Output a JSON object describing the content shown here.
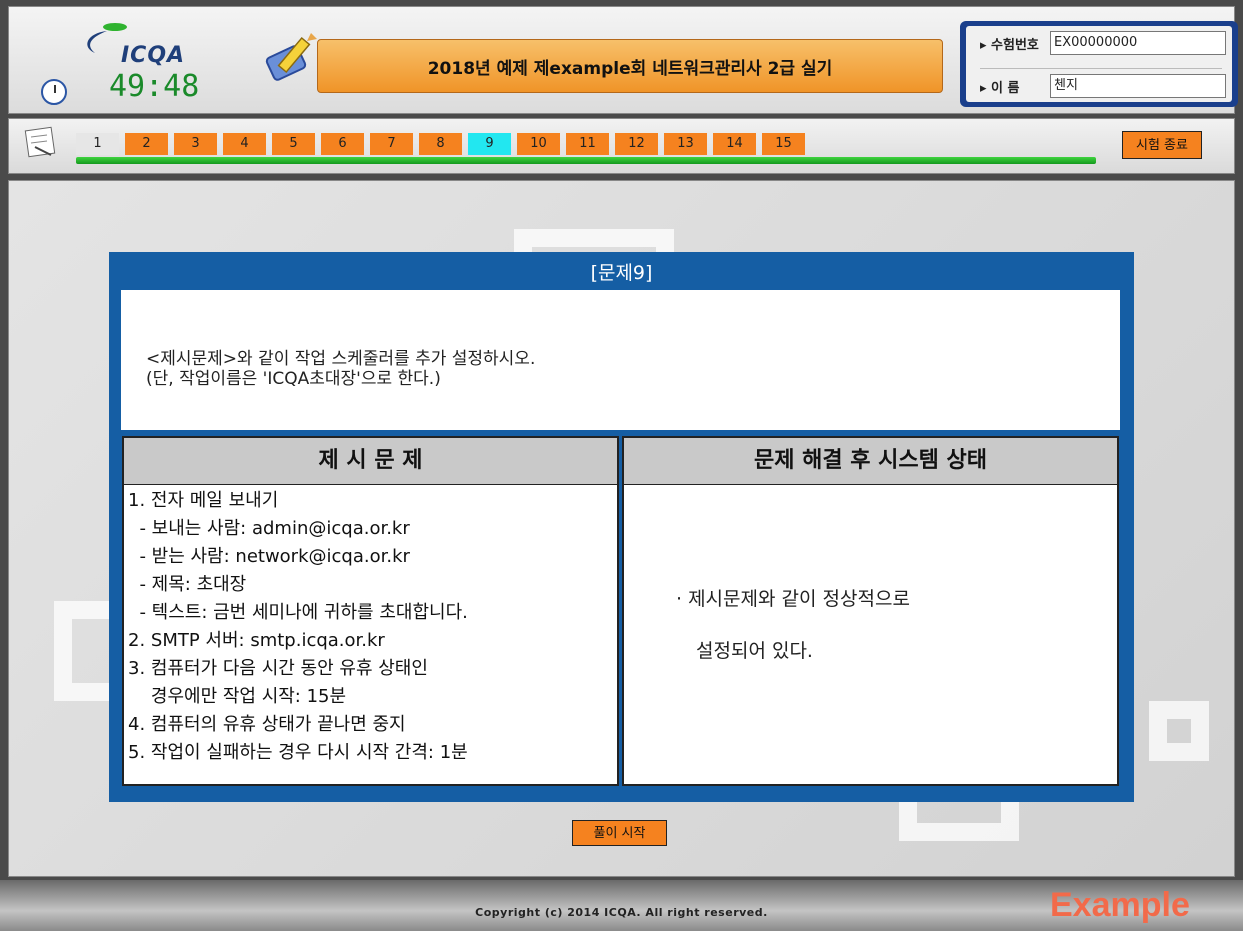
{
  "header": {
    "logo_text": "ICQA",
    "timer": "49:48",
    "title": "2018년 예제 제example회 네트워크관리사 2급 실기",
    "candidate": {
      "number_label": "▸ 수험번호",
      "number_value": "EX00000000",
      "name_label": "▸ 이     름",
      "name_value": "첸지"
    }
  },
  "nav": {
    "questions": [
      "1",
      "2",
      "3",
      "4",
      "5",
      "6",
      "7",
      "8",
      "9",
      "10",
      "11",
      "12",
      "13",
      "14",
      "15"
    ],
    "done": [
      "1"
    ],
    "current": "9",
    "end_button": "시험 종료"
  },
  "question": {
    "title": "[문제9]",
    "lines": [
      "<제시문제>와 같이 작업 스케줄러를 추가 설정하시오.",
      "(단, 작업이름은 'ICQA초대장'으로 한다.)"
    ],
    "left_header": "제 시 문 제",
    "conditions": [
      "1. 전자 메일 보내기",
      "  - 보내는 사람: admin@icqa.or.kr",
      "  - 받는 사람: network@icqa.or.kr",
      "  - 제목: 초대장",
      "  - 텍스트: 금번 세미나에 귀하를 초대합니다.",
      "2. SMTP 서버: smtp.icqa.or.kr",
      "3. 컴퓨터가 다음 시간 동안 유휴 상태인",
      "    경우에만 작업 시작: 15분",
      "4. 컴퓨터의 유휴 상태가 끝나면 중지",
      "5. 작업이 실패하는 경우 다시 시작 간격: 1분"
    ],
    "right_header": "문제 해결 후 시스템 상태",
    "state_lines": [
      "· 제시문제와 같이 정상적으로",
      "설정되어 있다."
    ]
  },
  "start_button": "풀이 시작",
  "footer": {
    "copyright": "Copyright (c) 2014 ICQA. All right reserved.",
    "watermark": "Example"
  }
}
